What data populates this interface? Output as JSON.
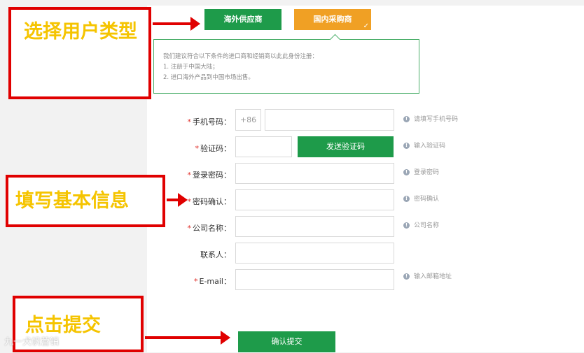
{
  "tabs": {
    "overseas": "海外供应商",
    "domestic": "国内采购商",
    "domestic_check": "✓"
  },
  "info": {
    "line1": "我们建议符合以下条件的进口商和经销商以此此身份注册：",
    "line2": "1. 注册于中国大陆；",
    "line3": "2. 进口海外产品到中国市场出售。"
  },
  "form": {
    "phone_label": "手机号码：",
    "phone_prefix": "+86",
    "phone_hint": "请填写手机号码",
    "code_label": "验证码：",
    "send_code": "发送验证码",
    "code_hint": "输入验证码",
    "password_label": "登录密码：",
    "password_hint": "登录密码",
    "confirm_label": "密码确认：",
    "confirm_hint": "密码确认",
    "company_label": "公司名称：",
    "company_hint": "公司名称",
    "contact_label": "联系人：",
    "email_label": "E-mail：",
    "email_hint": "输入邮箱地址",
    "required_mark": "*",
    "submit": "确认提交"
  },
  "annotations": {
    "select_type": "选择用户类型",
    "fill_info": "填写基本信息",
    "click_submit": "点击提交"
  },
  "watermark": "九一犬帆营销",
  "colors": {
    "green": "#1e9b4a",
    "orange": "#f0a024",
    "red": "#e00000",
    "annotation_text": "#f5c400"
  }
}
